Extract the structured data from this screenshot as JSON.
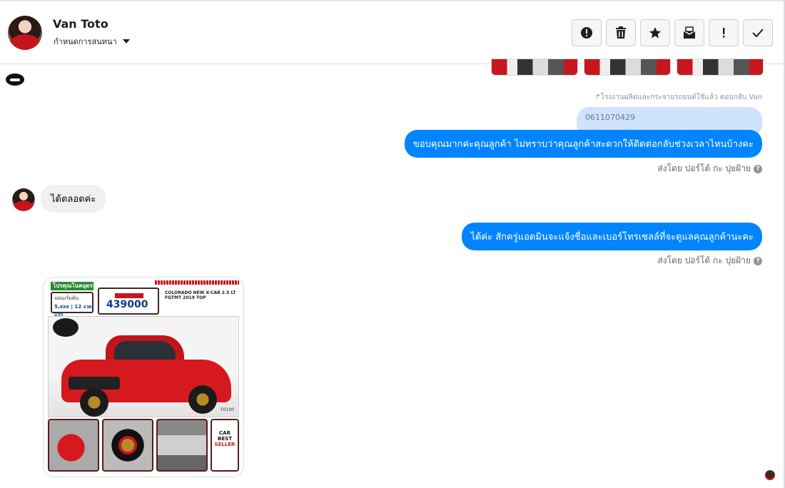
{
  "header": {
    "contact_name": "Van Toto",
    "subtitle": "กำหนดการสนทนา",
    "toolbar": [
      {
        "name": "report-icon",
        "glyph": "!"
      },
      {
        "name": "trash-icon",
        "glyph": ""
      },
      {
        "name": "star-icon",
        "glyph": "★"
      },
      {
        "name": "mark-unread-icon",
        "glyph": ""
      },
      {
        "name": "important-icon",
        "glyph": "!"
      },
      {
        "name": "check-icon",
        "glyph": "✓"
      }
    ]
  },
  "messages": {
    "reply_note": "โรงงานผลิตและกระจายรถยนต์ใช้แล้ว ตอบกลับ Van",
    "quoted_text": "0611070429",
    "out_1": "ขอบคุณมากค่ะคุณลูกค้า ไม่ทราบว่าคุณลูกค้าสะดวกให้ติดต่อกลับช่วงเวลาไหนบ้างคะ",
    "sent_by_1": "ส่งโดย ปอร์โต้ กะ ปุยฝ้าย",
    "in_1": "ได้ตลอดค่ะ",
    "out_2": "ได้ค่ะ สักครู่แอดมินจะแจ้งชื่อและเบอร์โทรเซลล์ที่จะดูแลคุณลูกค้านะคะ",
    "sent_by_2": "ส่งโดย ปอร์โต้ กะ ปุยฝ้าย",
    "help_glyph": "?"
  },
  "ad": {
    "headline": "โปรคุณโนคอุดร",
    "down_label": "ผ่อนเริ่มต้น",
    "down_payment": "5,xxx | 12 งวดแรก",
    "price": "439000",
    "model": "COLORADO NEW X-CAB 2.5 LT FGTMT 2019 TOP",
    "code": "F0100",
    "seller_badge_1": "CAR",
    "seller_badge_2": "BEST",
    "seller_badge_3": "SELLER"
  },
  "colors": {
    "accent": "#0084ff",
    "bubble_in": "#f0f0f0",
    "quoted": "#cfe3fc"
  }
}
